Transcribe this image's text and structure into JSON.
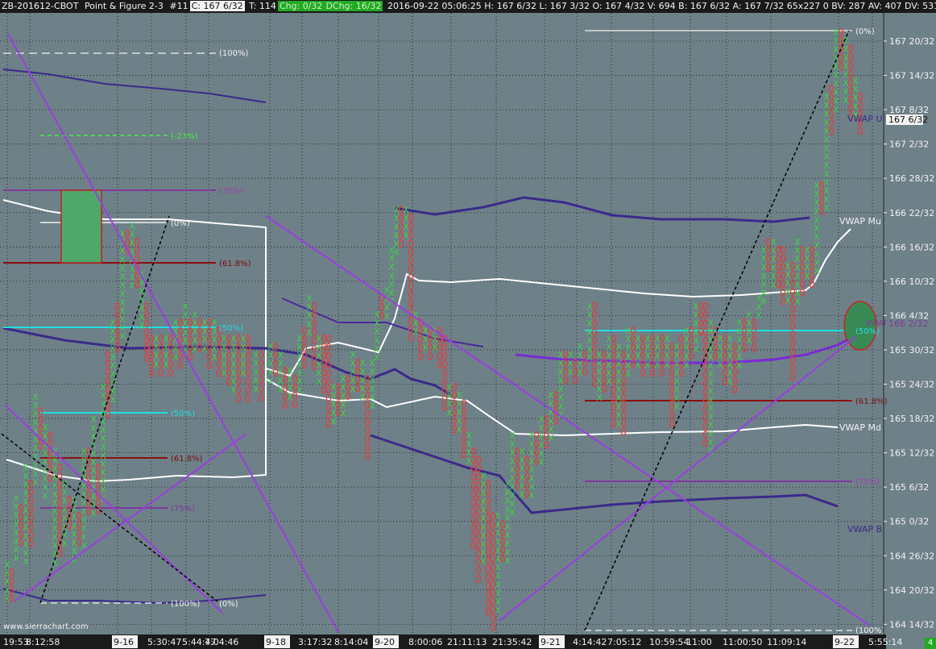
{
  "header": {
    "symbol": "ZB-201612-CBOT",
    "chart_type": "Point & Figure 2-3",
    "chart_num": "#11",
    "close": "C: 167 6/32",
    "ticks": "T: 114",
    "chg": "Chg: 0/32",
    "dchg": "DChg: 16/32",
    "stats": "2016-09-22 05:06:25 H: 167 6/32 L: 167 3/32 O: 167 4/32 V: 694 B: 167 6/32 A: 167 7/32 65x227 0 BV: 287 AV: 407 DV: 53164 Volu"
  },
  "colors": {
    "background": "#6e8088",
    "x_color": "#3fd14a",
    "o_color": "#e04040",
    "vwap_center": "#ffffff",
    "vwap_band": "#3a2a8a",
    "trendline": "#9a3ee0",
    "cyan_level": "#20e0e0",
    "red_level": "#8b1010",
    "purple_level": "#7d3a9a",
    "dashed_green": "#44ee44",
    "box_green": "#4fa86a"
  },
  "price_axis": [
    "167 20/32",
    "167 14/32",
    "167 8/32",
    "167 2/32",
    "166 28/32",
    "166 22/32",
    "166 16/32",
    "166 10/32",
    "166 4/32",
    "165 30/32",
    "165 24/32",
    "165 18/32",
    "165 12/32",
    "165 6/32",
    "165 0/32",
    "164 26/32",
    "164 20/32",
    "164 14/32"
  ],
  "current_price": "167 6/32",
  "vwap_price": "166 2/32",
  "time_axis": [
    "19:53",
    "8:12:58",
    "9-16",
    "5:30:47",
    "5:44:47",
    "7:04:46",
    "9-18",
    "3:17:32",
    "8:14:04",
    "9-20",
    "8:00:06",
    "21:11:13",
    "21:35:42",
    "9-21",
    "4:14:42",
    "7:05:12",
    "10:59:54",
    "11:00",
    "11:00:50",
    "11:09:14",
    "9-22",
    "5:55:14"
  ],
  "levels": {
    "p100_a": "(100%)",
    "m23": "(-23%)",
    "p75_a": "(75%)",
    "p0_a": "(0%)",
    "p618_a": "(61.8%)",
    "p50_a": "(50%)",
    "p50_b": "(50%)",
    "p618_b": "(61.8%)",
    "p75_b": "(75%)",
    "p100_b": "(100%)",
    "p0_b": "(0%)",
    "p0_c": "(0%)",
    "p50_c": "(50%)",
    "p618_c": "(61.8%)",
    "p75_c": "(75%)",
    "p100_c": "(100%)"
  },
  "vwap_labels": {
    "upper": "VWAP U",
    "mid_upper": "VWAP Mu",
    "mid": "VWAP Md",
    "bottom": "VWAP B",
    "center": "VWAP"
  },
  "watermark": "www.sierrachart.com",
  "status": "4"
}
